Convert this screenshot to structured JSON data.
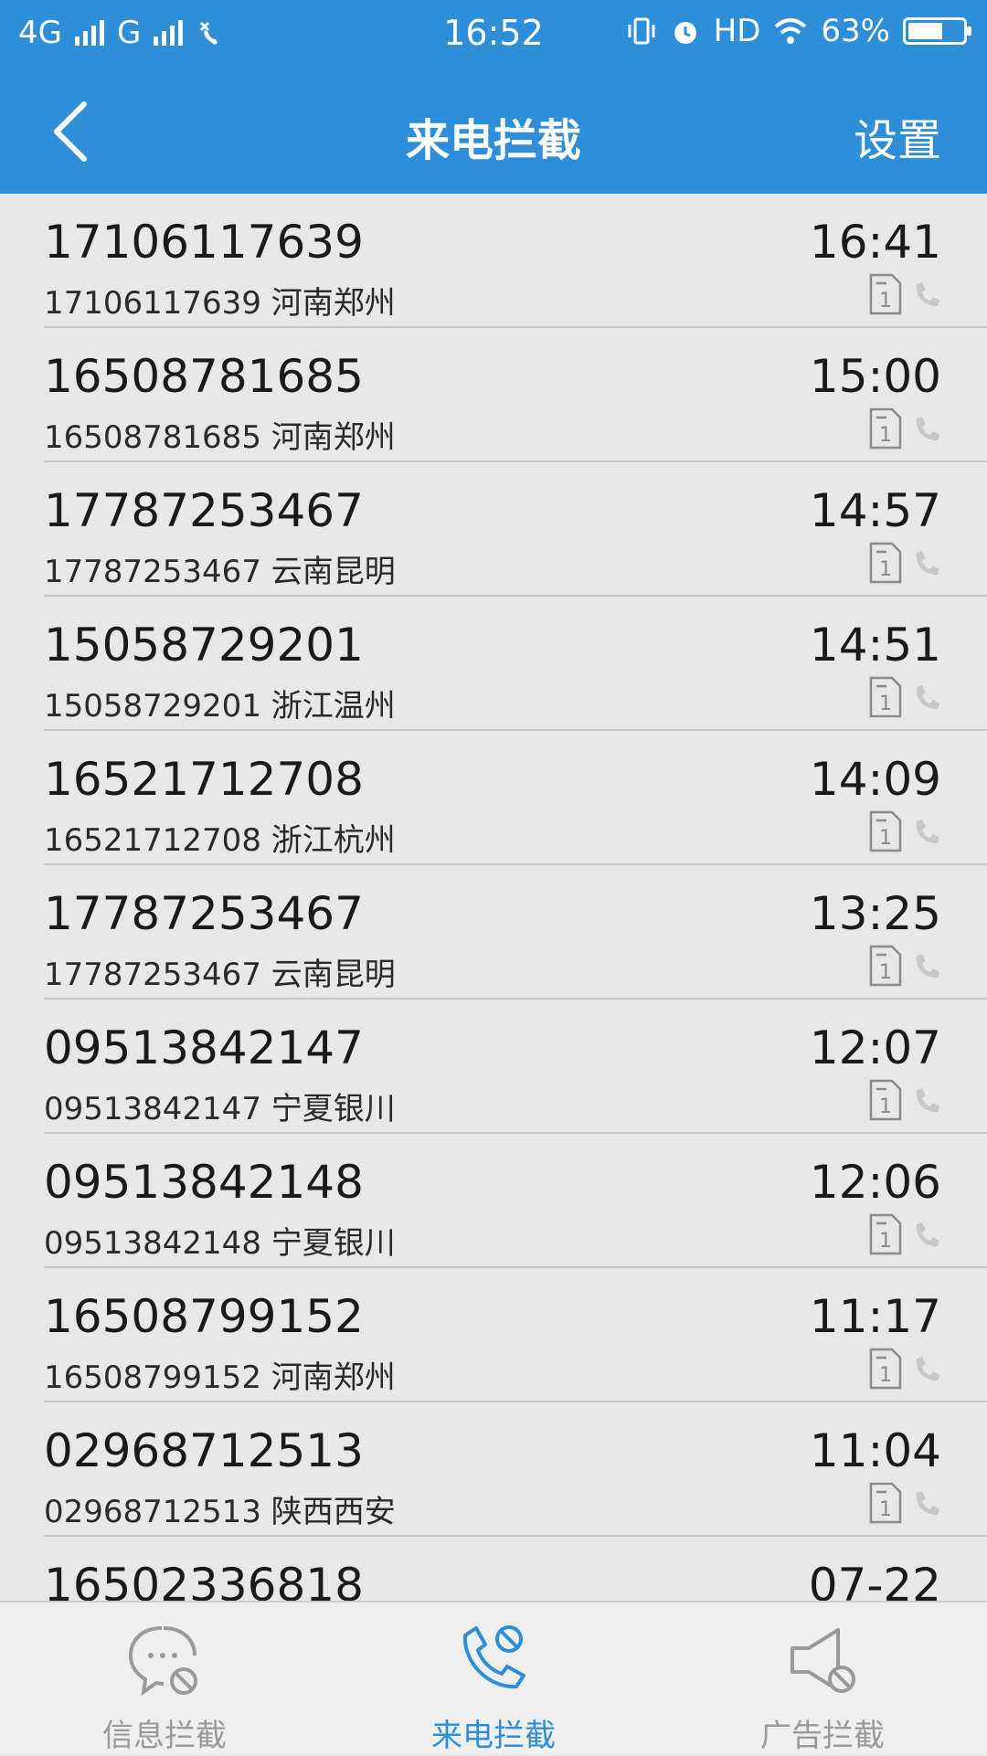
{
  "status_bar": {
    "network1": "4G",
    "network2": "G",
    "time": "16:52",
    "hd": "HD",
    "battery": "63%",
    "battery_level": 0.63
  },
  "header": {
    "title": "来电拦截",
    "settings_label": "设置"
  },
  "calls": [
    {
      "number": "17106117639",
      "detail": "17106117639 河南郑州",
      "time": "16:41"
    },
    {
      "number": "16508781685",
      "detail": "16508781685 河南郑州",
      "time": "15:00"
    },
    {
      "number": "17787253467",
      "detail": "17787253467 云南昆明",
      "time": "14:57"
    },
    {
      "number": "15058729201",
      "detail": "15058729201 浙江温州",
      "time": "14:51"
    },
    {
      "number": "16521712708",
      "detail": "16521712708 浙江杭州",
      "time": "14:09"
    },
    {
      "number": "17787253467",
      "detail": "17787253467 云南昆明",
      "time": "13:25"
    },
    {
      "number": "09513842147",
      "detail": "09513842147 宁夏银川",
      "time": "12:07"
    },
    {
      "number": "09513842148",
      "detail": "09513842148 宁夏银川",
      "time": "12:06"
    },
    {
      "number": "16508799152",
      "detail": "16508799152 河南郑州",
      "time": "11:17"
    },
    {
      "number": "02968712513",
      "detail": "02968712513 陕西西安",
      "time": "11:04"
    },
    {
      "number": "16502336818",
      "detail": "",
      "time": "07-22"
    }
  ],
  "sim_label": "1",
  "tabs": [
    {
      "label": "信息拦截",
      "icon": "message-block-icon",
      "active": false
    },
    {
      "label": "来电拦截",
      "icon": "call-block-icon",
      "active": true
    },
    {
      "label": "广告拦截",
      "icon": "ad-block-icon",
      "active": false
    }
  ],
  "colors": {
    "accent": "#2e8fd8",
    "background": "#e8e8e8",
    "tab_inactive": "#9a9a9a"
  }
}
